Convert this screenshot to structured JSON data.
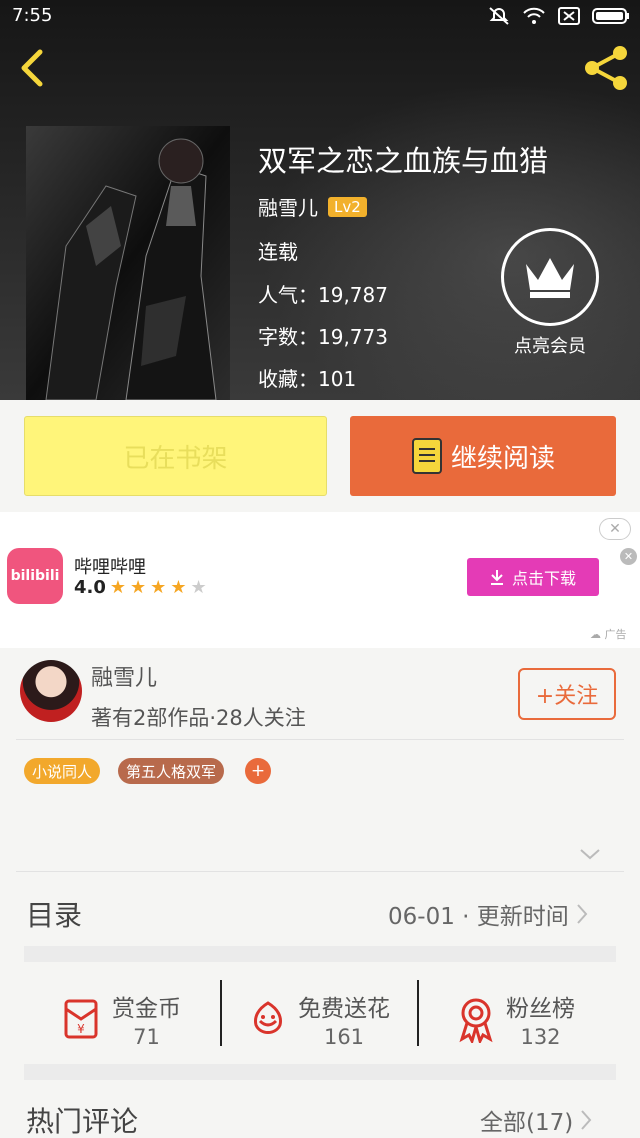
{
  "status_bar": {
    "time": "7:55"
  },
  "book": {
    "title": "双军之恋之血族与血猎",
    "author": "融雪儿",
    "level": "Lv2",
    "status": "连载",
    "popularity": "人气：19,787",
    "word_count": "字数：19,773",
    "favorites": "收藏：101"
  },
  "vip": {
    "label": "点亮会员"
  },
  "actions": {
    "shelf_label": "已在书架",
    "read_label": "继续阅读"
  },
  "ad": {
    "app_name": "哔哩哔哩",
    "logo_text": "bilibili",
    "rating": "4.0",
    "stars": 4,
    "download_label": "点击下载",
    "tag": "广告"
  },
  "author_card": {
    "name": "融雪儿",
    "subtitle": "著有2部作品·28人关注",
    "follow_label": "+关注",
    "tags": [
      {
        "label": "小说同人",
        "color": "#f2a82c"
      },
      {
        "label": "第五人格双军",
        "color": "#b86a4c"
      }
    ],
    "add_tag_label": "+"
  },
  "directory": {
    "label": "目录",
    "update_info": "06-01 · 更新时间"
  },
  "stats": [
    {
      "label": "赏金币",
      "value": "71"
    },
    {
      "label": "免费送花",
      "value": "161"
    },
    {
      "label": "粉丝榜",
      "value": "132"
    }
  ],
  "comments": {
    "label": "热门评论",
    "all_label": "全部(17)"
  },
  "colors": {
    "accent": "#e96a3b",
    "shelf_yellow": "#fff57a",
    "badge_gold": "#f2b12c",
    "ad_button": "#e43bb6"
  }
}
